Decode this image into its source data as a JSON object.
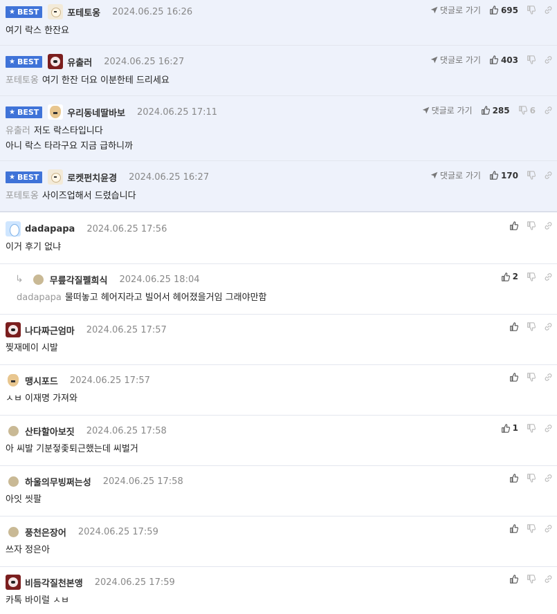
{
  "best_label": "BEST",
  "goto_label": "댓글로 가기",
  "best": [
    {
      "author": "포테토옹",
      "date": "2024.06.25 16:26",
      "mention": "",
      "lines": [
        "여기 락스 한잔요"
      ],
      "likes": "695",
      "dislikes": "",
      "avatar": "dog"
    },
    {
      "author": "유출러",
      "date": "2024.06.25 16:27",
      "mention": "포테토옹",
      "lines": [
        "여기 한잔 더요 이분한테 드리세요"
      ],
      "likes": "403",
      "dislikes": "",
      "avatar": "red"
    },
    {
      "author": "우리동네딸바보",
      "date": "2024.06.25 17:11",
      "mention": "유출러",
      "lines": [
        "저도 락스타입니다",
        "아니 락스 타라구요 지금 급하니까"
      ],
      "likes": "285",
      "dislikes": "6",
      "avatar": "chi"
    },
    {
      "author": "로켓펀치윤경",
      "date": "2024.06.25 16:27",
      "mention": "포테토옹",
      "lines": [
        "사이즈업해서 드렸습니다"
      ],
      "likes": "170",
      "dislikes": "",
      "avatar": "dog"
    }
  ],
  "comments": [
    {
      "author": "dadapapa",
      "date": "2024.06.25 17:56",
      "mention": "",
      "text": "이거 후기 없냐",
      "likes": "",
      "reply": false,
      "avatar": "blue"
    },
    {
      "author": "무릎각질펠희식",
      "date": "2024.06.25 18:04",
      "mention": "dadapapa",
      "text": "물떠놓고 헤어지라고 빌어서 헤어졌을거임 그래야만함",
      "likes": "2",
      "reply": true,
      "avatar": "circle"
    },
    {
      "author": "나다짜근엄마",
      "date": "2024.06.25 17:57",
      "mention": "",
      "text": "찢재메이 시발",
      "likes": "",
      "reply": false,
      "avatar": "red"
    },
    {
      "author": "맹시포드",
      "date": "2024.06.25 17:57",
      "mention": "",
      "text": "ㅅㅂ 이재명 가져와",
      "likes": "",
      "reply": false,
      "avatar": "chi"
    },
    {
      "author": "산타할아보짓",
      "date": "2024.06.25 17:58",
      "mention": "",
      "text": "아 씨발 기분젛좇퇴근했는데 씨벌거",
      "likes": "1",
      "reply": false,
      "avatar": "circle"
    },
    {
      "author": "하울의무빙쩌는성",
      "date": "2024.06.25 17:58",
      "mention": "",
      "text": "아잇 씻팔",
      "likes": "",
      "reply": false,
      "avatar": "circle"
    },
    {
      "author": "풍천은장어",
      "date": "2024.06.25 17:59",
      "mention": "",
      "text": "쓰자 정은아",
      "likes": "",
      "reply": false,
      "avatar": "circle"
    },
    {
      "author": "비듬각질천본앵",
      "date": "2024.06.25 17:59",
      "mention": "",
      "text": "카톡 바이럴 ㅅㅂ",
      "likes": "",
      "reply": false,
      "avatar": "red"
    }
  ]
}
